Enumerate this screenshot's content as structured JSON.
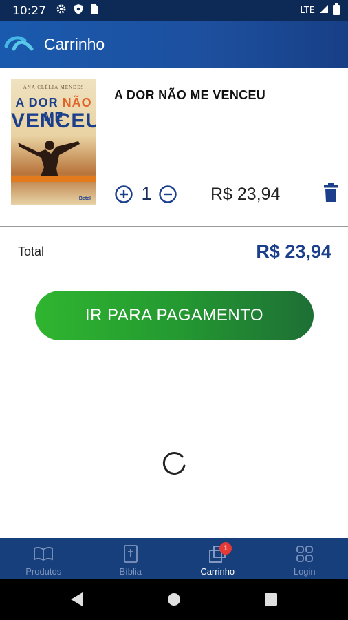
{
  "status_bar": {
    "time": "10:27",
    "network": "LTE",
    "icons": [
      "gear-icon",
      "shield-icon",
      "sim-card-icon",
      "signal-icon",
      "battery-icon"
    ]
  },
  "app_bar": {
    "title": "Carrinho",
    "logo": "app-logo-icon",
    "background_color": "#1a5aae"
  },
  "cart": {
    "items": [
      {
        "title": "A DOR NÃO ME VENCEU",
        "quantity": "1",
        "price": "R$ 23,94",
        "cover": {
          "author": "ANA CLÉLIA MENDES",
          "title_line1_a": "A DOR ",
          "title_line1_b": "NÃO",
          "title_line1_c": " ME",
          "title_line2": "VENCEU",
          "publisher": "Betel"
        }
      }
    ]
  },
  "total": {
    "label": "Total",
    "value": "R$ 23,94",
    "color": "#1c3f8c"
  },
  "checkout": {
    "button_label": "IR PARA PAGAMENTO",
    "color": "#2fb52f"
  },
  "bottom_nav": {
    "items": [
      {
        "label": "Produtos",
        "icon": "open-book-icon",
        "active": false
      },
      {
        "label": "Bíblia",
        "icon": "bible-icon",
        "active": false
      },
      {
        "label": "Carrinho",
        "icon": "cart-icon",
        "active": true,
        "badge": "1"
      },
      {
        "label": "Login",
        "icon": "grid-icon",
        "active": false
      }
    ]
  },
  "system_nav": [
    "back-icon",
    "home-icon",
    "recents-icon"
  ]
}
